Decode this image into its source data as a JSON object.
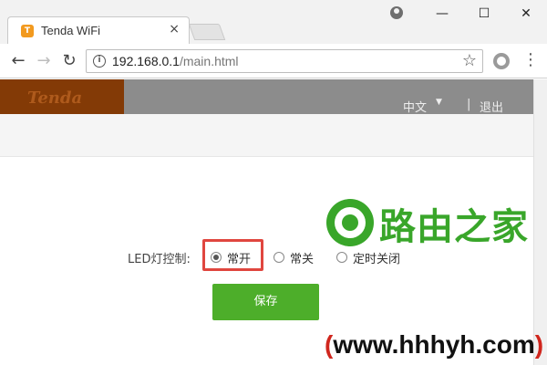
{
  "browser": {
    "tab_title": "Tenda WiFi",
    "tab_close": "×",
    "favicon_text": "T",
    "url_host": "192.168.0.1",
    "url_path": "/main.html",
    "window_controls": {
      "minimize": "—",
      "maximize": "☐",
      "close": "✕"
    },
    "nav": {
      "back": "←",
      "forward": "→",
      "reload": "↻"
    },
    "menu": "⋮",
    "star": "☆",
    "info": "i"
  },
  "router": {
    "logo": "Tenda",
    "language": "中文",
    "language_caret": "▼",
    "separator": "|",
    "logout": "退出"
  },
  "led": {
    "label": "LED灯控制:",
    "options": [
      {
        "label": "常开",
        "checked": true
      },
      {
        "label": "常关",
        "checked": false
      },
      {
        "label": "定时关闭",
        "checked": false
      }
    ],
    "save_label": "保存"
  },
  "watermark": {
    "name": "路由之家",
    "url_open": "(",
    "url": "www.hhhyh.com",
    "url_close": ")"
  },
  "colors": {
    "logo_bg": "#833a06",
    "header_bg": "#8c8c8c",
    "save_button": "#4dae2a",
    "highlight": "#e0463f",
    "watermark_green": "#39a62a"
  }
}
